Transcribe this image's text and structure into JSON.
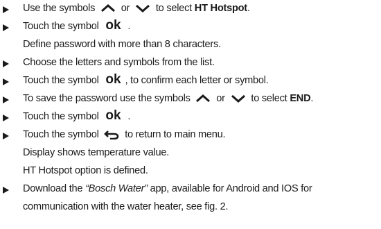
{
  "steps": [
    {
      "parts": [
        "Use the symbols",
        "or",
        "to select",
        "HT Hotspot",
        "."
      ]
    },
    {
      "parts": [
        "Touch the symbol",
        "ok",
        "."
      ],
      "sub": [
        "Define password with more than 8 characters."
      ]
    },
    {
      "parts": [
        "Choose the letters and symbols from the list."
      ]
    },
    {
      "parts": [
        "Touch the symbol",
        "ok",
        ", to confirm each letter or symbol."
      ]
    },
    {
      "parts": [
        "To save the password use the symbols",
        "or",
        "to select",
        "END",
        "."
      ]
    },
    {
      "parts": [
        "Touch the symbol",
        "ok",
        "."
      ]
    },
    {
      "parts": [
        "Touch the symbol",
        "to return to main menu."
      ],
      "sub": [
        "Display shows temperature value.",
        "HT Hotspot option is defined."
      ]
    },
    {
      "parts": [
        "Download the",
        "“Bosch Water”",
        "app, available for Android and IOS for"
      ],
      "sub": [
        "communication with the water heater, see fig. 2."
      ]
    }
  ],
  "icons": {
    "up": "chevron-up-icon",
    "down": "chevron-down-icon",
    "ok": "ok-symbol",
    "back": "return-arrow-icon"
  }
}
